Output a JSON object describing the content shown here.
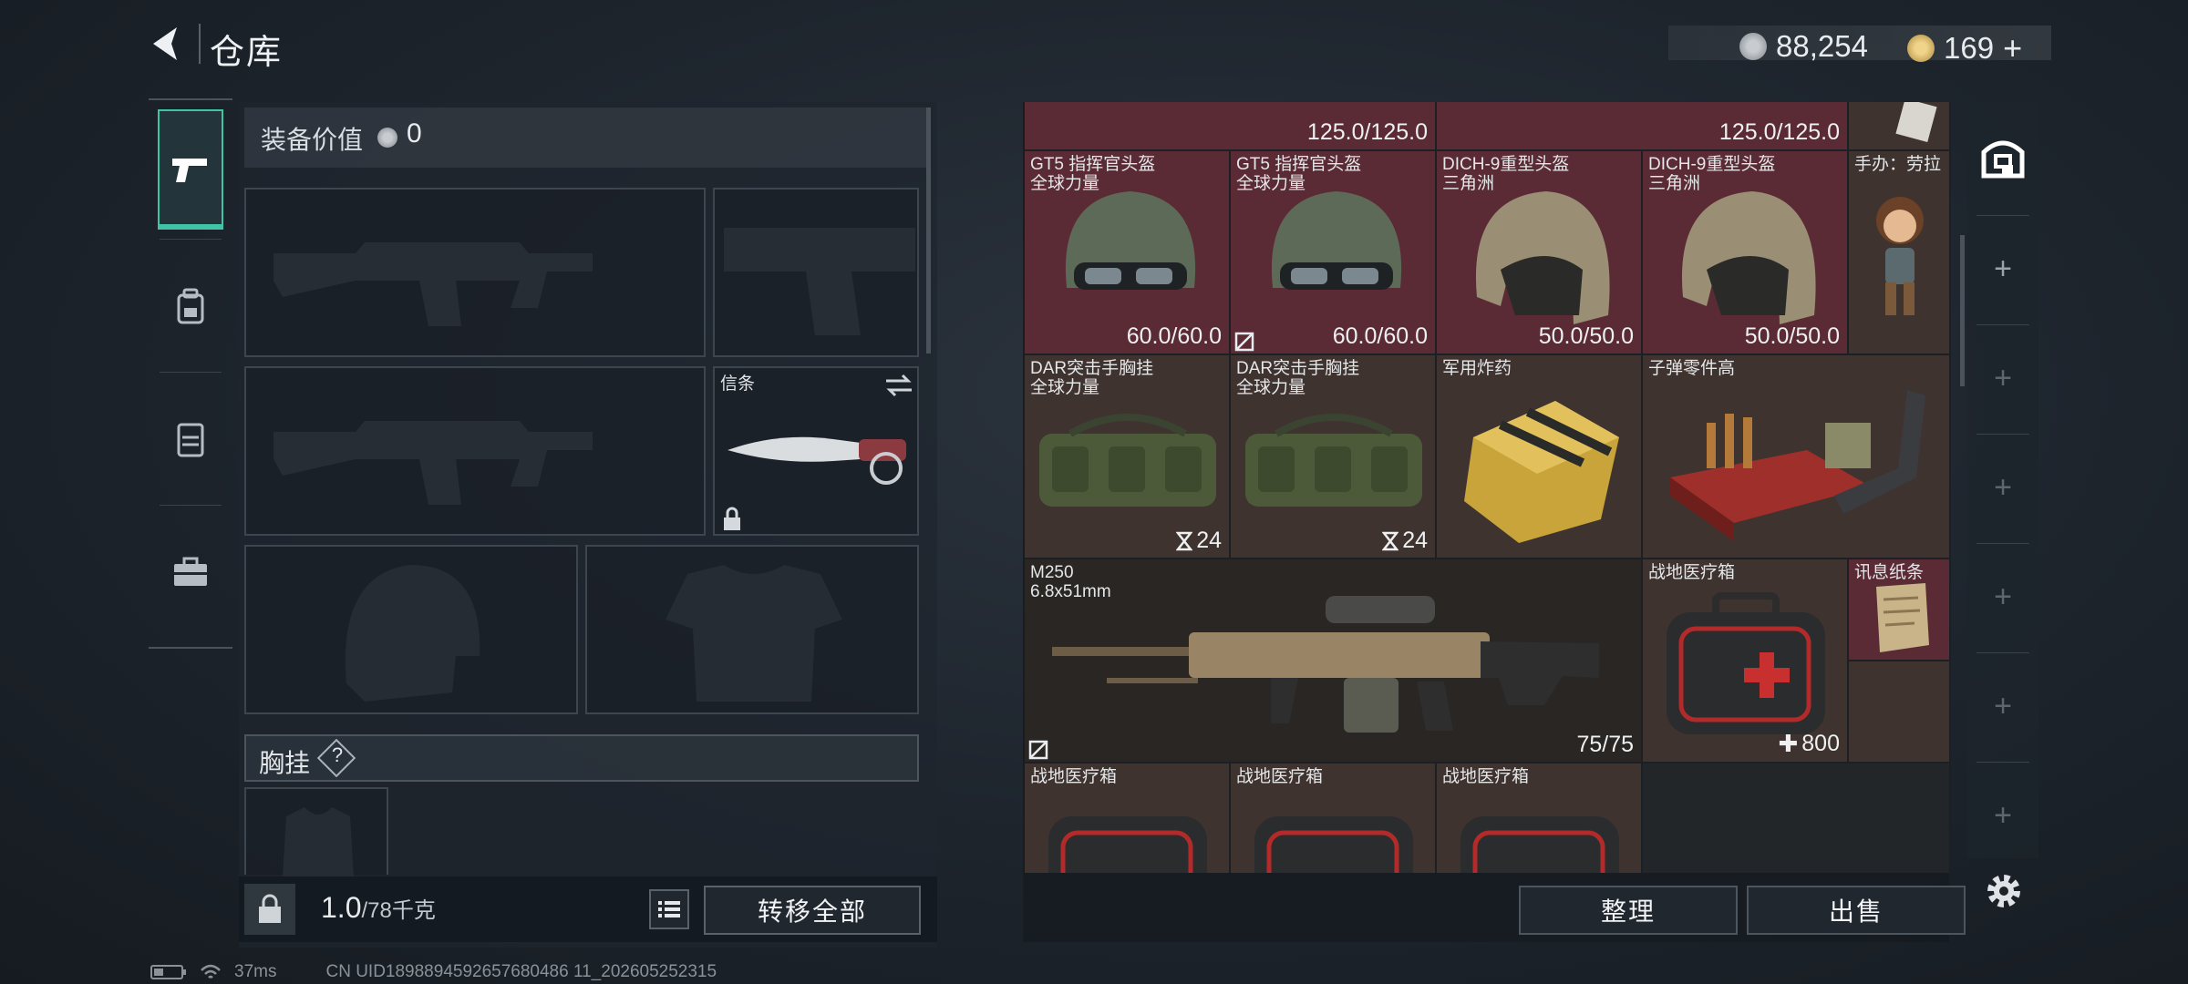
{
  "header": {
    "title": "仓库",
    "currency1": "88,254",
    "currency2": "169",
    "currency2_plus": "+"
  },
  "equip": {
    "value_label": "装备价值",
    "value": "0",
    "melee_label": "信条",
    "chest_label": "胸挂",
    "chest_help": "?"
  },
  "weight": {
    "value": "1.0",
    "capacity": "/78千克"
  },
  "buttons": {
    "transfer_all": "转移全部",
    "sort": "整理",
    "sell": "出售"
  },
  "inventory": {
    "top_row": [
      {
        "durability": "125.0/125.0"
      },
      {
        "durability": "125.0/125.0"
      }
    ],
    "helmets": [
      {
        "name": "GT5 指挥官头盔",
        "sub": "全球力量",
        "durability": "60.0/60.0"
      },
      {
        "name": "GT5 指挥官头盔",
        "sub": "全球力量",
        "durability": "60.0/60.0"
      },
      {
        "name": "DICH-9重型头盔",
        "sub": "三角洲",
        "durability": "50.0/50.0"
      },
      {
        "name": "DICH-9重型头盔",
        "sub": "三角洲",
        "durability": "50.0/50.0"
      }
    ],
    "figure": {
      "name": "手办：劳拉"
    },
    "vests": [
      {
        "name": "DAR突击手胸挂",
        "sub": "全球力量",
        "capacity": "24"
      },
      {
        "name": "DAR突击手胸挂",
        "sub": "全球力量",
        "capacity": "24"
      }
    ],
    "explosive": {
      "name": "军用炸药"
    },
    "ammo_parts": {
      "name": "子弹零件高"
    },
    "m250": {
      "name": "M250",
      "caliber": "6.8x51mm",
      "ammo": "75/75"
    },
    "medkit": {
      "name": "战地医疗箱",
      "value": "800"
    },
    "intel": {
      "name": "讯息纸条"
    },
    "bottom_row": [
      {
        "name": "战地医疗箱"
      },
      {
        "name": "战地医疗箱"
      },
      {
        "name": "战地医疗箱"
      }
    ]
  },
  "status": {
    "ping": "37ms",
    "uid": "CN UID1898894592657680486 11_202605252315"
  },
  "colors": {
    "accent": "#3fc4a5",
    "red_cell": "#5b2b35",
    "brown_cell": "#3f3330"
  },
  "icons": [
    "back-arrow-icon",
    "coin-icon",
    "gem-icon",
    "gun-icon",
    "backpack-icon",
    "vest-icon",
    "briefcase-icon",
    "lock-icon",
    "list-icon",
    "safe-box-icon",
    "plus-icon",
    "settings-gear-icon",
    "battery-icon",
    "wifi-icon",
    "swap-icon"
  ]
}
